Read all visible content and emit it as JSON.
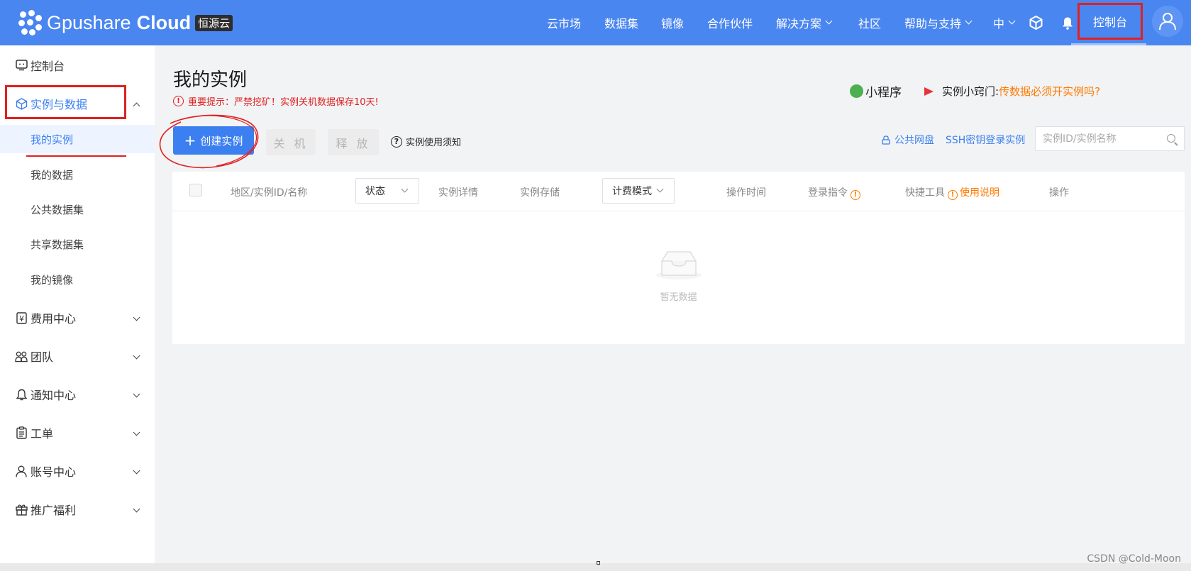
{
  "header": {
    "logo_text": "Gpushare",
    "logo_bold": "Cloud",
    "logo_badge": "恒源云",
    "nav": [
      {
        "label": "云市场"
      },
      {
        "label": "数据集"
      },
      {
        "label": "镜像"
      },
      {
        "label": "合作伙伴"
      },
      {
        "label": "解决方案"
      },
      {
        "label": "社区"
      },
      {
        "label": "帮助与支持"
      },
      {
        "label": "中"
      }
    ],
    "console": "控制台"
  },
  "sidebar": {
    "console": "控制台",
    "instances_data": "实例与数据",
    "sub": [
      {
        "label": "我的实例"
      },
      {
        "label": "我的数据"
      },
      {
        "label": "公共数据集"
      },
      {
        "label": "共享数据集"
      },
      {
        "label": "我的镜像"
      }
    ],
    "groups": [
      {
        "label": "费用中心"
      },
      {
        "label": "团队"
      },
      {
        "label": "通知中心"
      },
      {
        "label": "工单"
      },
      {
        "label": "账号中心"
      },
      {
        "label": "推广福利"
      }
    ]
  },
  "main": {
    "title": "我的实例",
    "warning": "重要提示：严禁挖矿！实例关机数据保存10天!",
    "mini_program": "小程序",
    "tip_label": "实例小窍门:",
    "tip_link": "传数据必须开实例吗?",
    "create_btn": "创建实例",
    "shutdown_btn": "关 机",
    "release_btn": "释 放",
    "usage_notice": "实例使用须知",
    "public_disk": "公共网盘",
    "ssh_login": "SSH密钥登录实例",
    "search_placeholder": "实例ID/实例名称",
    "columns": {
      "region": "地区/实例ID/名称",
      "status": "状态",
      "details": "实例详情",
      "storage": "实例存储",
      "billing": "计费模式",
      "op_time": "操作时间",
      "login_cmd": "登录指令",
      "quick_tools": "快捷工具",
      "usage_help": "使用说明",
      "actions": "操作"
    },
    "empty": "暂无数据"
  },
  "watermark": "CSDN @Cold-Moon",
  "colors": {
    "primary": "#4a86f0",
    "accent": "#3b7ff0",
    "warning": "#e02020",
    "orange": "#ff7a00"
  }
}
